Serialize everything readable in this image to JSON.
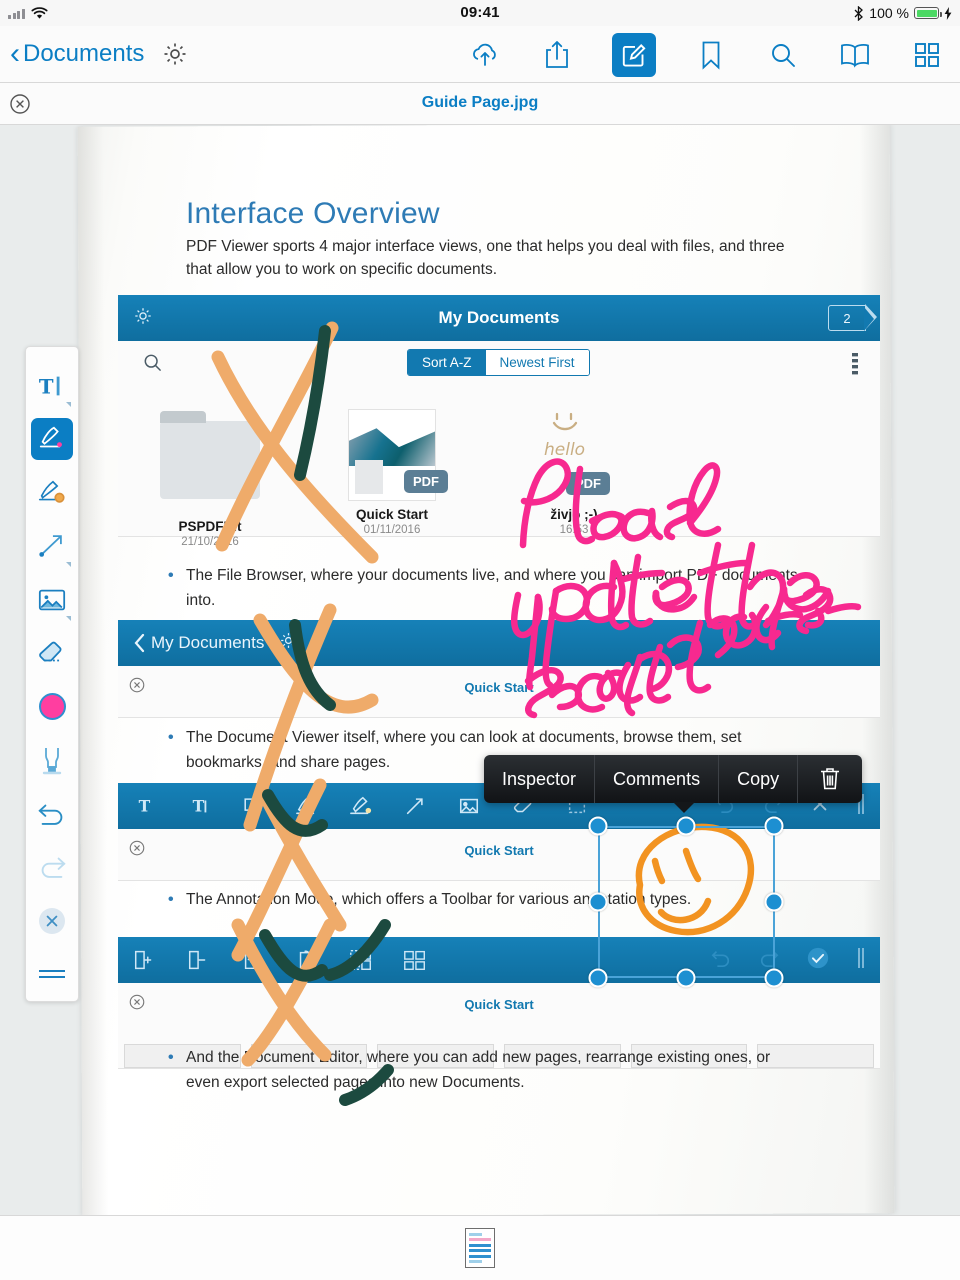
{
  "status_bar": {
    "time": "09:41",
    "battery_percent": "100 %",
    "signal_icon": "cellular-signal-icon",
    "wifi_icon": "wifi-icon",
    "bluetooth_icon": "bluetooth-icon",
    "charging_icon": "lightning-bolt-icon"
  },
  "nav_bar": {
    "back_label": "Documents",
    "back_chevron": "‹",
    "settings_icon": "gear-icon",
    "icons": [
      {
        "name": "cloud-upload-icon",
        "active": false
      },
      {
        "name": "share-icon",
        "active": false
      },
      {
        "name": "annotate-icon",
        "active": true
      },
      {
        "name": "bookmark-icon",
        "active": false
      },
      {
        "name": "search-icon",
        "active": false
      },
      {
        "name": "reader-book-icon",
        "active": false
      },
      {
        "name": "grid-thumbnails-icon",
        "active": false
      }
    ]
  },
  "sub_bar": {
    "close_icon": "close-circle-icon",
    "document_title": "Guide Page.jpg"
  },
  "document": {
    "heading": "Interface Overview",
    "intro": "PDF Viewer sports 4 major interface views, one that helps you deal with files, and three that allow you to work on specific documents.",
    "bullets": [
      "The File Browser, where your documents live, and where you can import PDF documents into.",
      "The Document Viewer itself, where you can look at documents, browse them, set bookmarks, and share pages.",
      "The Annotation Mode, which offers a Toolbar for various annotation types.",
      "And the Document Editor, where you can add new pages, rearrange existing ones, or even export selected pages into new Documents."
    ],
    "file_browser_panel": {
      "title": "My Documents",
      "page_badge": "2",
      "gear_icon": "gear-icon",
      "search_icon": "search-icon",
      "more_icon": "more-options-icon",
      "sort_segments": [
        {
          "label": "Sort A-Z",
          "selected": true
        },
        {
          "label": "Newest First",
          "selected": false
        }
      ],
      "files": [
        {
          "name": "PSPDFKit",
          "date": "21/10/2016",
          "kind": "folder"
        },
        {
          "name": "Quick Start",
          "date": "01/11/2016",
          "kind": "pdf",
          "badge": "PDF"
        },
        {
          "name": "živjo ;-)",
          "date": "16:53",
          "kind": "pdf",
          "badge": "PDF"
        }
      ]
    },
    "document_viewer_panel": {
      "back_label": "My Documents",
      "gear_icon": "gear-icon",
      "page_title": "Quick Start",
      "close_icon": "close-circle-icon"
    },
    "annotation_panel": {
      "page_title": "Quick Start",
      "close_icon": "close-circle-icon",
      "tools": [
        "text-annotation-icon",
        "text-box-icon",
        "note-comment-icon",
        "pen-icon",
        "highlighter-icon",
        "arrow-line-icon",
        "image-stamp-icon",
        "eraser-icon",
        "marquee-select-icon"
      ],
      "right_tools": [
        "undo-icon",
        "redo-icon",
        "close-x-icon",
        "drag-handle-icon"
      ]
    },
    "document_editor_panel": {
      "page_title": "Quick Start",
      "close_icon": "close-circle-icon",
      "tools": [
        "add-page-icon",
        "remove-page-icon",
        "insert-page-icon",
        "rotate-page-icon",
        "duplicate-page-icon",
        "select-all-pages-icon"
      ],
      "right_tools": [
        "undo-icon",
        "redo-icon",
        "confirm-check-icon",
        "drag-handle-icon"
      ]
    }
  },
  "annotations": {
    "handwritten_note": "Please update the screenshots-",
    "handwritten_note_color": "#f7298f",
    "cross_out_color": "#efab6a",
    "cross_out_dark_color": "#1c4a3f",
    "smiley_color": "#f29321",
    "selection_handle_color": "#1d8fd1"
  },
  "context_menu": {
    "items": [
      {
        "label": "Inspector",
        "icon": null
      },
      {
        "label": "Comments",
        "icon": null
      },
      {
        "label": "Copy",
        "icon": null
      },
      {
        "label": "",
        "icon": "trash-icon"
      }
    ]
  },
  "tool_palette": {
    "tools": [
      {
        "name": "text-tool",
        "icon": "text-cursor-icon",
        "selected": false
      },
      {
        "name": "pen-tool",
        "icon": "pen-icon",
        "selected": true
      },
      {
        "name": "highlighter-tool",
        "icon": "highlighter-icon",
        "selected": false
      },
      {
        "name": "line-tool",
        "icon": "arrow-line-icon",
        "selected": false
      },
      {
        "name": "image-tool",
        "icon": "image-icon",
        "selected": false
      },
      {
        "name": "eraser-tool",
        "icon": "eraser-icon",
        "selected": false
      },
      {
        "name": "color-swatch",
        "icon": "color-circle-icon",
        "selected": false,
        "color": "#ff3ea0"
      },
      {
        "name": "marker-tool",
        "icon": "marker-icon",
        "selected": false
      },
      {
        "name": "undo",
        "icon": "undo-icon",
        "selected": false
      },
      {
        "name": "redo",
        "icon": "redo-icon",
        "selected": false,
        "disabled": true
      },
      {
        "name": "close-palette",
        "icon": "close-x-icon",
        "selected": false
      },
      {
        "name": "palette-drag-handle",
        "icon": "drag-handle-icon",
        "selected": false
      }
    ]
  },
  "bottom_bar": {
    "page_thumbnail_icon": "page-thumbnail-icon"
  }
}
